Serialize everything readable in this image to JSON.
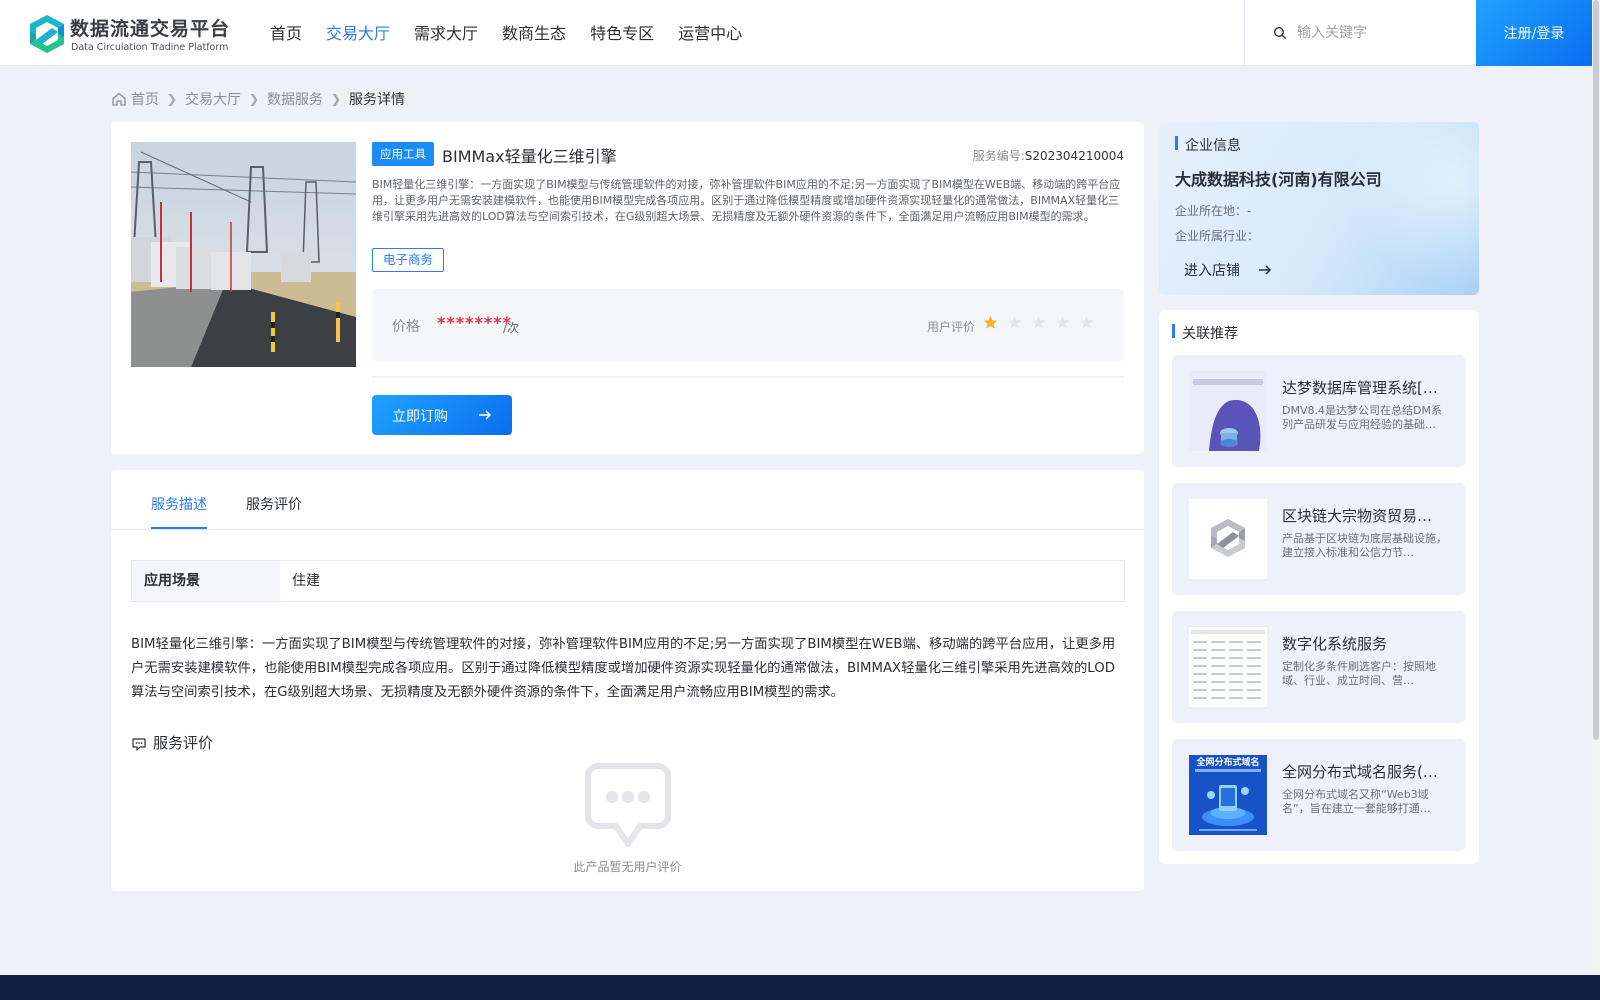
{
  "header": {
    "logo_cn": "数据流通交易平台",
    "logo_en": "Data Circulation Tradine Platform",
    "nav": [
      "首页",
      "交易大厅",
      "需求大厅",
      "数商生态",
      "特色专区",
      "运营中心"
    ],
    "search_placeholder": "输入关键字",
    "login_label": "注册/登录"
  },
  "breadcrumb": [
    "首页",
    "交易大厅",
    "数据服务",
    "服务详情"
  ],
  "product": {
    "type_tag": "应用工具",
    "title": "BIMMax轻量化三维引擎",
    "service_no_label": "服务编号:",
    "service_no": "S202304210004",
    "description": "BIM轻量化三维引擎：一方面实现了BIM模型与传统管理软件的对接，弥补管理软件BIM应用的不足;另一方面实现了BIM模型在WEB端、移动端的跨平台应用，让更多用户无需安装建模软件，也能使用BIM模型完成各项应用。区别于通过降低模型精度或增加硬件资源实现轻量化的通常做法，BIMMAX轻量化三维引擎采用先进高效的LOD算法与空间索引技术，在G级别超大场景、无损精度及无额外硬件资源的条件下，全面满足用户流畅应用BIM模型的需求。",
    "category_tag": "电子商务",
    "price_label": "价格",
    "price_value": "********",
    "price_unit": "/次",
    "rating_label": "用户评价",
    "rating": 1,
    "rating_max": 5,
    "buy_label": "立即订购"
  },
  "company": {
    "heading": "企业信息",
    "name": "大成数据科技(河南)有限公司",
    "location": "企业所在地：-",
    "industry": "企业所属行业：",
    "enter_label": "进入店铺"
  },
  "related": {
    "heading": "关联推荐",
    "items": [
      {
        "title": "达梦数据库管理系统[…",
        "desc": "DMV8.4是达梦公司在总结DM系列产品研发与应用经验的基础…",
        "thumb": "dameng-db-icon"
      },
      {
        "title": "区块链大宗物资贸易…",
        "desc": "产品基于区块链为底层基础设施，建立接入标准和公信力节…",
        "thumb": "platform-logo-icon"
      },
      {
        "title": "数字化系统服务",
        "desc": "定制化多条件刷选客户：按照地域、行业、成立时间、营…",
        "thumb": "spreadsheet-icon"
      },
      {
        "title": "全网分布式域名服务(…",
        "desc": "全网分布式域名又称“Web3域名”，旨在建立一套能够打通…",
        "thumb": "domain-banner-icon",
        "thumb_text": "全网分布式域名"
      }
    ]
  },
  "detail": {
    "tabs": [
      "服务描述",
      "服务评价"
    ],
    "scene_label": "应用场景",
    "scene_value": "住建",
    "text": "BIM轻量化三维引擎：一方面实现了BIM模型与传统管理软件的对接，弥补管理软件BIM应用的不足;另一方面实现了BIM模型在WEB端、移动端的跨平台应用，让更多用户无需安装建模软件，也能使用BIM模型完成各项应用。区别于通过降低模型精度或增加硬件资源实现轻量化的通常做法，BIMMAX轻量化三维引擎采用先进高效的LOD算法与空间索引技术，在G级别超大场景、无损精度及无额外硬件资源的条件下，全面满足用户流畅应用BIM模型的需求。",
    "review_heading": "服务评价",
    "empty_text": "此产品暂无用户评价"
  },
  "colors": {
    "accent": "#2b7bf2",
    "price": "#f0313e",
    "star_on": "#f5b324",
    "star_off": "#e3e5ea"
  }
}
